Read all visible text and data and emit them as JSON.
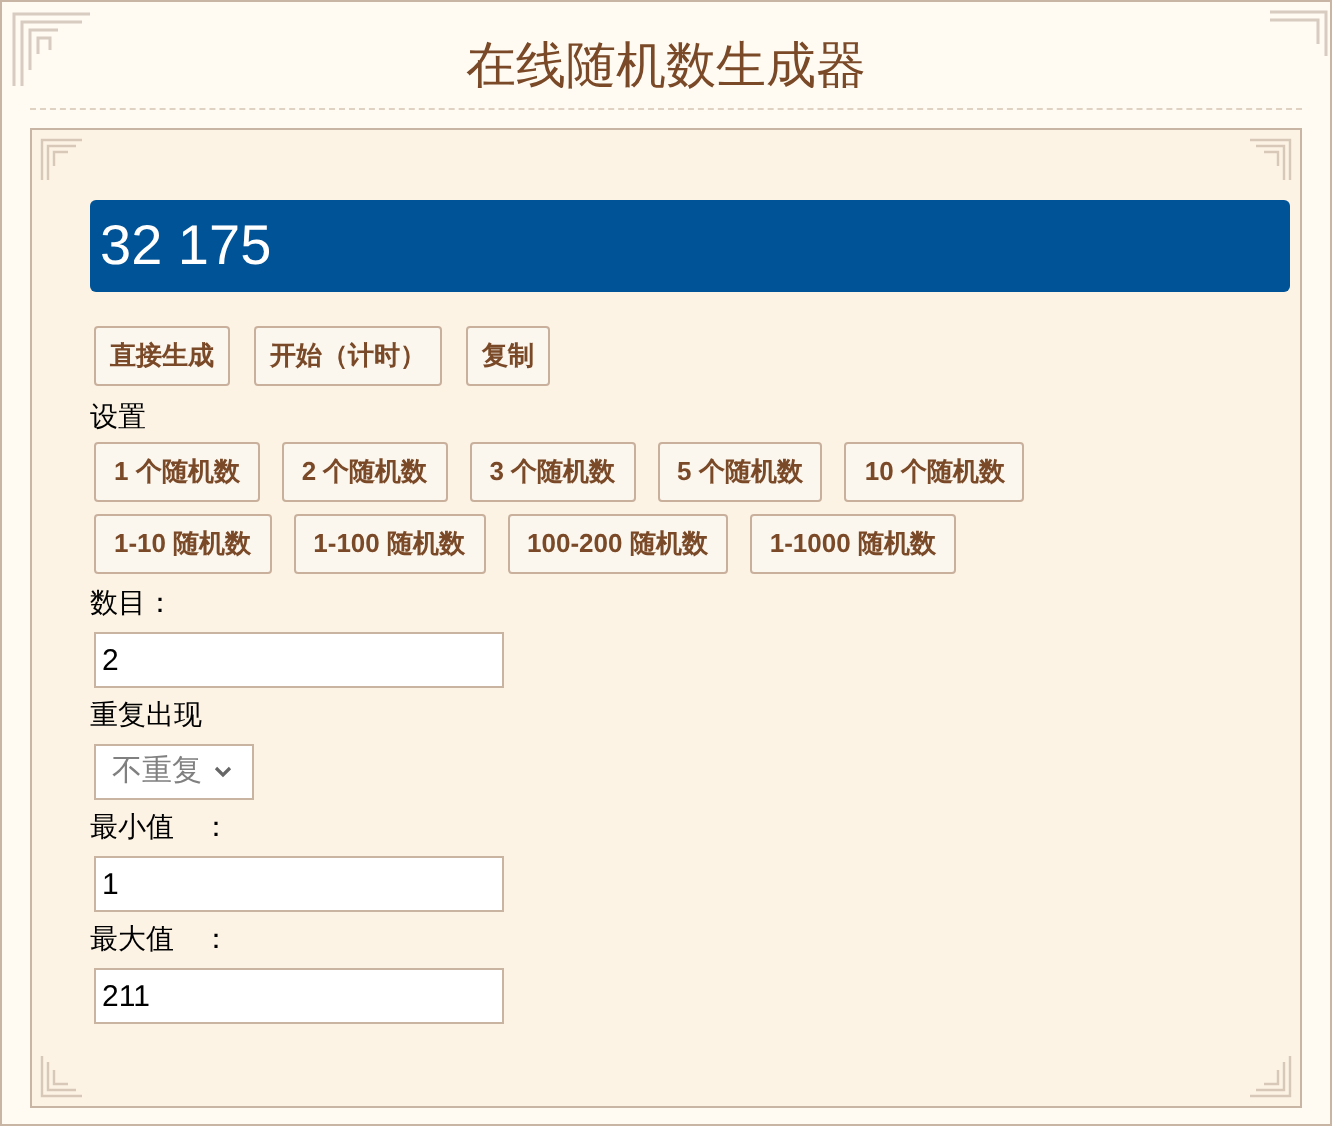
{
  "title": "在线随机数生成器",
  "result": "32 175",
  "actions": [
    "直接生成",
    "开始（计时）",
    "复制"
  ],
  "settings_label": "设置",
  "preset_rows": [
    [
      "1 个随机数",
      "2 个随机数",
      "3 个随机数",
      "5 个随机数",
      "10 个随机数"
    ],
    [
      "1-10 随机数",
      "1-100 随机数",
      "100-200 随机数",
      "1-1000 随机数"
    ]
  ],
  "fields": [
    {
      "kind": "input",
      "label": "数目：",
      "value": "2"
    },
    {
      "kind": "select",
      "label": "重复出现",
      "value": "不重复"
    },
    {
      "kind": "input",
      "label": "最小值　：",
      "value": "1"
    },
    {
      "kind": "input",
      "label": "最大值　：",
      "value": "211"
    }
  ]
}
